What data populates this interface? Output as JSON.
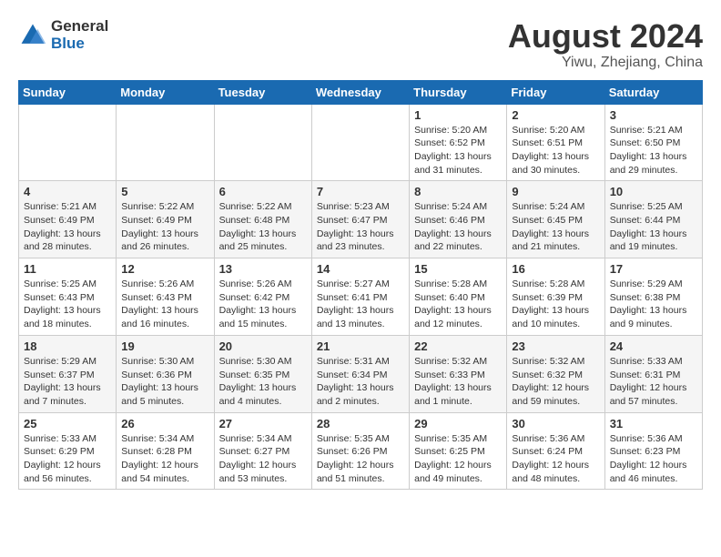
{
  "header": {
    "logo_line1": "General",
    "logo_line2": "Blue",
    "month_year": "August 2024",
    "location": "Yiwu, Zhejiang, China"
  },
  "days_of_week": [
    "Sunday",
    "Monday",
    "Tuesday",
    "Wednesday",
    "Thursday",
    "Friday",
    "Saturday"
  ],
  "weeks": [
    [
      {
        "day": "",
        "info": ""
      },
      {
        "day": "",
        "info": ""
      },
      {
        "day": "",
        "info": ""
      },
      {
        "day": "",
        "info": ""
      },
      {
        "day": "1",
        "info": "Sunrise: 5:20 AM\nSunset: 6:52 PM\nDaylight: 13 hours\nand 31 minutes."
      },
      {
        "day": "2",
        "info": "Sunrise: 5:20 AM\nSunset: 6:51 PM\nDaylight: 13 hours\nand 30 minutes."
      },
      {
        "day": "3",
        "info": "Sunrise: 5:21 AM\nSunset: 6:50 PM\nDaylight: 13 hours\nand 29 minutes."
      }
    ],
    [
      {
        "day": "4",
        "info": "Sunrise: 5:21 AM\nSunset: 6:49 PM\nDaylight: 13 hours\nand 28 minutes."
      },
      {
        "day": "5",
        "info": "Sunrise: 5:22 AM\nSunset: 6:49 PM\nDaylight: 13 hours\nand 26 minutes."
      },
      {
        "day": "6",
        "info": "Sunrise: 5:22 AM\nSunset: 6:48 PM\nDaylight: 13 hours\nand 25 minutes."
      },
      {
        "day": "7",
        "info": "Sunrise: 5:23 AM\nSunset: 6:47 PM\nDaylight: 13 hours\nand 23 minutes."
      },
      {
        "day": "8",
        "info": "Sunrise: 5:24 AM\nSunset: 6:46 PM\nDaylight: 13 hours\nand 22 minutes."
      },
      {
        "day": "9",
        "info": "Sunrise: 5:24 AM\nSunset: 6:45 PM\nDaylight: 13 hours\nand 21 minutes."
      },
      {
        "day": "10",
        "info": "Sunrise: 5:25 AM\nSunset: 6:44 PM\nDaylight: 13 hours\nand 19 minutes."
      }
    ],
    [
      {
        "day": "11",
        "info": "Sunrise: 5:25 AM\nSunset: 6:43 PM\nDaylight: 13 hours\nand 18 minutes."
      },
      {
        "day": "12",
        "info": "Sunrise: 5:26 AM\nSunset: 6:43 PM\nDaylight: 13 hours\nand 16 minutes."
      },
      {
        "day": "13",
        "info": "Sunrise: 5:26 AM\nSunset: 6:42 PM\nDaylight: 13 hours\nand 15 minutes."
      },
      {
        "day": "14",
        "info": "Sunrise: 5:27 AM\nSunset: 6:41 PM\nDaylight: 13 hours\nand 13 minutes."
      },
      {
        "day": "15",
        "info": "Sunrise: 5:28 AM\nSunset: 6:40 PM\nDaylight: 13 hours\nand 12 minutes."
      },
      {
        "day": "16",
        "info": "Sunrise: 5:28 AM\nSunset: 6:39 PM\nDaylight: 13 hours\nand 10 minutes."
      },
      {
        "day": "17",
        "info": "Sunrise: 5:29 AM\nSunset: 6:38 PM\nDaylight: 13 hours\nand 9 minutes."
      }
    ],
    [
      {
        "day": "18",
        "info": "Sunrise: 5:29 AM\nSunset: 6:37 PM\nDaylight: 13 hours\nand 7 minutes."
      },
      {
        "day": "19",
        "info": "Sunrise: 5:30 AM\nSunset: 6:36 PM\nDaylight: 13 hours\nand 5 minutes."
      },
      {
        "day": "20",
        "info": "Sunrise: 5:30 AM\nSunset: 6:35 PM\nDaylight: 13 hours\nand 4 minutes."
      },
      {
        "day": "21",
        "info": "Sunrise: 5:31 AM\nSunset: 6:34 PM\nDaylight: 13 hours\nand 2 minutes."
      },
      {
        "day": "22",
        "info": "Sunrise: 5:32 AM\nSunset: 6:33 PM\nDaylight: 13 hours\nand 1 minute."
      },
      {
        "day": "23",
        "info": "Sunrise: 5:32 AM\nSunset: 6:32 PM\nDaylight: 12 hours\nand 59 minutes."
      },
      {
        "day": "24",
        "info": "Sunrise: 5:33 AM\nSunset: 6:31 PM\nDaylight: 12 hours\nand 57 minutes."
      }
    ],
    [
      {
        "day": "25",
        "info": "Sunrise: 5:33 AM\nSunset: 6:29 PM\nDaylight: 12 hours\nand 56 minutes."
      },
      {
        "day": "26",
        "info": "Sunrise: 5:34 AM\nSunset: 6:28 PM\nDaylight: 12 hours\nand 54 minutes."
      },
      {
        "day": "27",
        "info": "Sunrise: 5:34 AM\nSunset: 6:27 PM\nDaylight: 12 hours\nand 53 minutes."
      },
      {
        "day": "28",
        "info": "Sunrise: 5:35 AM\nSunset: 6:26 PM\nDaylight: 12 hours\nand 51 minutes."
      },
      {
        "day": "29",
        "info": "Sunrise: 5:35 AM\nSunset: 6:25 PM\nDaylight: 12 hours\nand 49 minutes."
      },
      {
        "day": "30",
        "info": "Sunrise: 5:36 AM\nSunset: 6:24 PM\nDaylight: 12 hours\nand 48 minutes."
      },
      {
        "day": "31",
        "info": "Sunrise: 5:36 AM\nSunset: 6:23 PM\nDaylight: 12 hours\nand 46 minutes."
      }
    ]
  ]
}
